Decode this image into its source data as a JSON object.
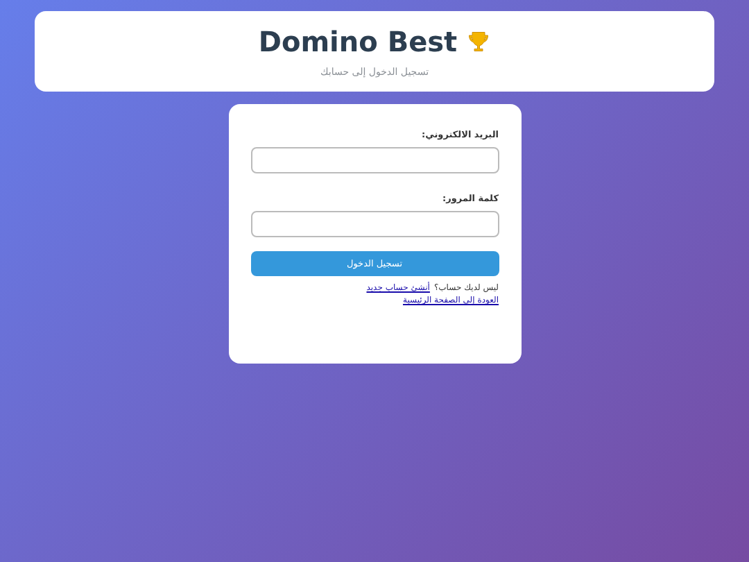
{
  "header": {
    "title": "Domino Best",
    "subtitle": "تسجيل الدخول إلى حسابك"
  },
  "form": {
    "fields": [
      {
        "label": "البريد الالكتروني:"
      },
      {
        "label": "كلمة المرور:"
      }
    ],
    "submit": "تسجيل الدخول",
    "signup": {
      "text": "ليس لديك حساب؟",
      "link": "أنشئ حساب جديد"
    },
    "back_link": "العودة إلى الصفحة الرئيسية"
  }
}
